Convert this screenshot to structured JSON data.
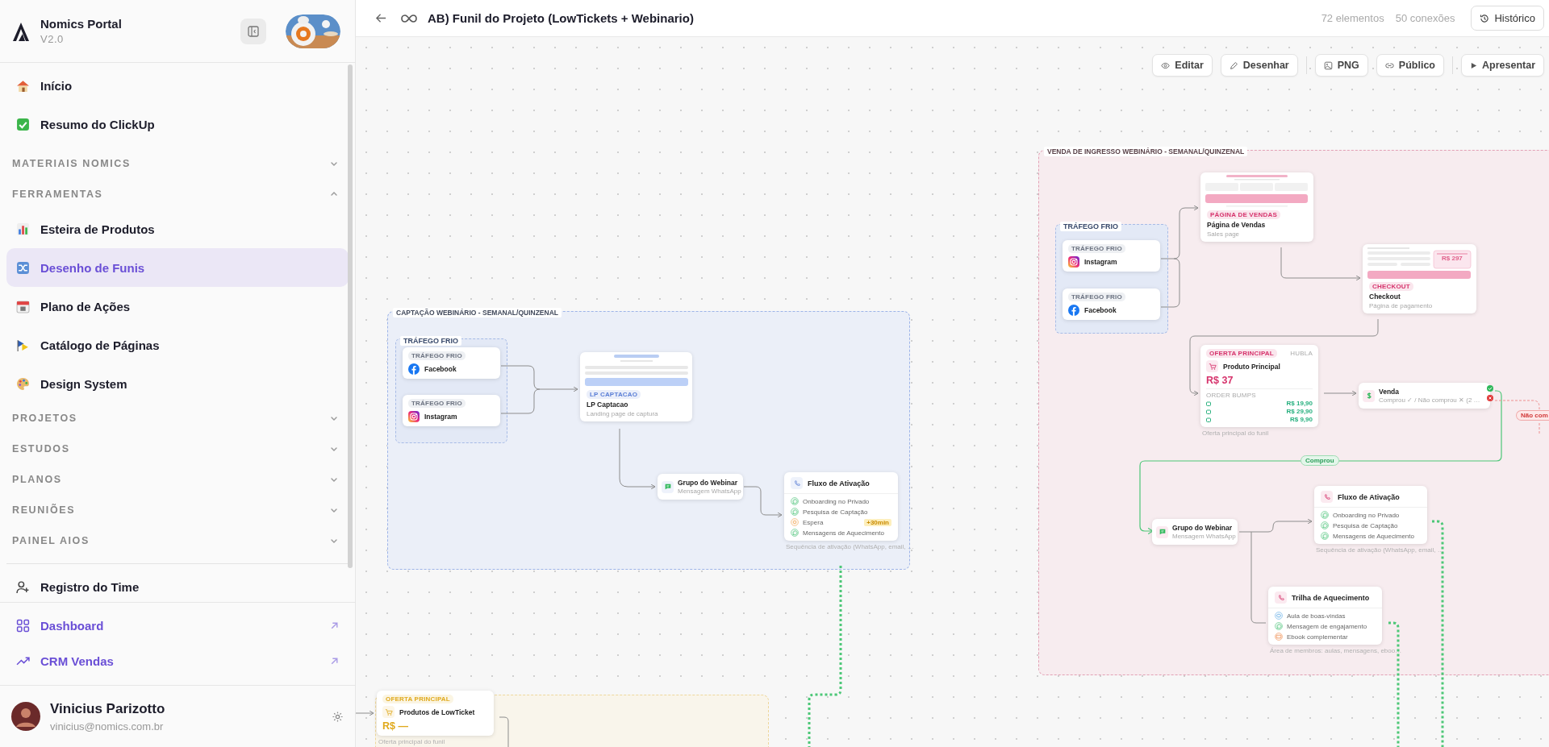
{
  "sidebar": {
    "brand": {
      "name": "Nomics Portal",
      "version": "V2.0"
    },
    "nav": [
      {
        "kind": "link",
        "label": "Início",
        "selected": false
      },
      {
        "kind": "link",
        "label": "Resumo do ClickUp",
        "selected": false
      },
      {
        "kind": "section",
        "label": "MATERIAIS NOMICS",
        "expanded": false
      },
      {
        "kind": "section",
        "label": "FERRAMENTAS",
        "expanded": true
      },
      {
        "kind": "link",
        "label": "Esteira de Produtos",
        "selected": false
      },
      {
        "kind": "link",
        "label": "Desenho de Funis",
        "selected": true
      },
      {
        "kind": "link",
        "label": "Plano de Ações",
        "selected": false
      },
      {
        "kind": "link",
        "label": "Catálogo de Páginas",
        "selected": false
      },
      {
        "kind": "link",
        "label": "Design System",
        "selected": false
      },
      {
        "kind": "section",
        "label": "PROJETOS",
        "expanded": false
      },
      {
        "kind": "section",
        "label": "ESTUDOS",
        "expanded": false
      },
      {
        "kind": "section",
        "label": "PLANOS",
        "expanded": false
      },
      {
        "kind": "section",
        "label": "REUNIÕES",
        "expanded": false
      },
      {
        "kind": "section",
        "label": "PAINEL AIOS",
        "expanded": false
      },
      {
        "kind": "link",
        "label": "Registro do Time",
        "selected": false
      }
    ],
    "external_links": [
      {
        "label": "Dashboard"
      },
      {
        "label": "CRM Vendas"
      }
    ],
    "user": {
      "name": "Vinicius Parizotto",
      "email": "vinicius@nomics.com.br"
    }
  },
  "header": {
    "title": "AB) Funil do Projeto (LowTickets + Webinario)",
    "stats": [
      "72 elementos",
      "50 conexões"
    ],
    "history_button": "Histórico"
  },
  "canvas": {
    "toolbar": [
      {
        "label": "Editar"
      },
      {
        "label": "Desenhar"
      },
      {
        "label": "PNG"
      },
      {
        "label": "Público"
      },
      {
        "label": "Apresentar"
      }
    ],
    "groups": [
      {
        "title": "CAPTAÇÃO WEBINÁRIO - SEMANAL/QUINZENAL",
        "color": "#9db4e8"
      },
      {
        "title": "VENDA DE INGRESSO WEBINÁRIO - SEMANAL/QUINZENAL",
        "color": "#e3a1b5"
      },
      {
        "color": "#eed79c"
      }
    ],
    "clusters": [
      {
        "title": "TRÁFEGO FRIO"
      },
      {
        "title": "TRÁFEGO FRIO"
      }
    ],
    "nodes": [
      {
        "kind": "source",
        "tag": "TRÁFEGO FRIO",
        "name": "Facebook"
      },
      {
        "kind": "source",
        "tag": "TRÁFEGO FRIO",
        "name": "Instagram"
      },
      {
        "kind": "page",
        "tag": "LP CAPTACAO",
        "title": "LP Captacao",
        "subtitle": "Landing page de captura"
      },
      {
        "kind": "message",
        "title": "Grupo do Webinar",
        "subtitle": "Mensagem WhatsApp"
      },
      {
        "kind": "sequence",
        "title": "Fluxo de Ativação",
        "caption": "Sequência de ativação (WhatsApp, email, …",
        "steps": [
          {
            "kind": "message",
            "text": "Onboarding no Privado"
          },
          {
            "kind": "message",
            "text": "Pesquisa de Captação"
          },
          {
            "kind": "wait",
            "text": "Espera",
            "badge": "+30min"
          },
          {
            "kind": "message",
            "text": "Mensagens de Aquecimento"
          }
        ]
      },
      {
        "kind": "source",
        "tag": "TRÁFEGO FRIO",
        "name": "Instagram"
      },
      {
        "kind": "source",
        "tag": "TRÁFEGO FRIO",
        "name": "Facebook"
      },
      {
        "kind": "page",
        "tag": "PÁGINA DE VENDAS",
        "title": "Página de Vendas",
        "subtitle": "Sales page"
      },
      {
        "kind": "page",
        "tag": "CHECKOUT",
        "title": "Checkout",
        "subtitle": "Página de pagamento",
        "mock_price": "R$ 297"
      },
      {
        "kind": "offer",
        "tag": "OFERTA PRINCIPAL",
        "platform": "HUBLA",
        "title": "Produto Principal",
        "price": "R$ 37",
        "bumps_label": "ORDER BUMPS",
        "bumps": [
          "R$ 19,90",
          "R$ 29,90",
          "R$ 9,90"
        ],
        "caption": "Oferta principal do funil"
      },
      {
        "kind": "decision",
        "title": "Venda",
        "subtitle": "Comprou ✓ / Não comprou ✕ (2 …"
      },
      {
        "kind": "message",
        "title": "Grupo do Webinar",
        "subtitle": "Mensagem WhatsApp"
      },
      {
        "kind": "sequence",
        "title": "Fluxo de Ativação",
        "caption": "Sequência de ativação (WhatsApp, email, …",
        "steps": [
          {
            "kind": "message",
            "text": "Onboarding no Privado"
          },
          {
            "kind": "message",
            "text": "Pesquisa de Captação"
          },
          {
            "kind": "message",
            "text": "Mensagens de Aquecimento"
          }
        ]
      },
      {
        "kind": "sequence",
        "title": "Trilha de Aquecimento",
        "caption": "Área de membros: aulas, mensagens, eboo…",
        "steps": [
          {
            "kind": "video",
            "text": "Aula de boas-vindas"
          },
          {
            "kind": "message",
            "text": "Mensagem de engajamento"
          },
          {
            "kind": "book",
            "text": "Ebook complementar"
          }
        ]
      },
      {
        "kind": "offer",
        "tag": "OFERTA PRINCIPAL",
        "title": "Produtos de LowTicket",
        "price": "R$ —",
        "caption": "Oferta principal do funil"
      }
    ],
    "edge_labels": [
      {
        "kind": "yes",
        "text": "Comprou"
      },
      {
        "kind": "no",
        "text": "Não com"
      }
    ]
  }
}
